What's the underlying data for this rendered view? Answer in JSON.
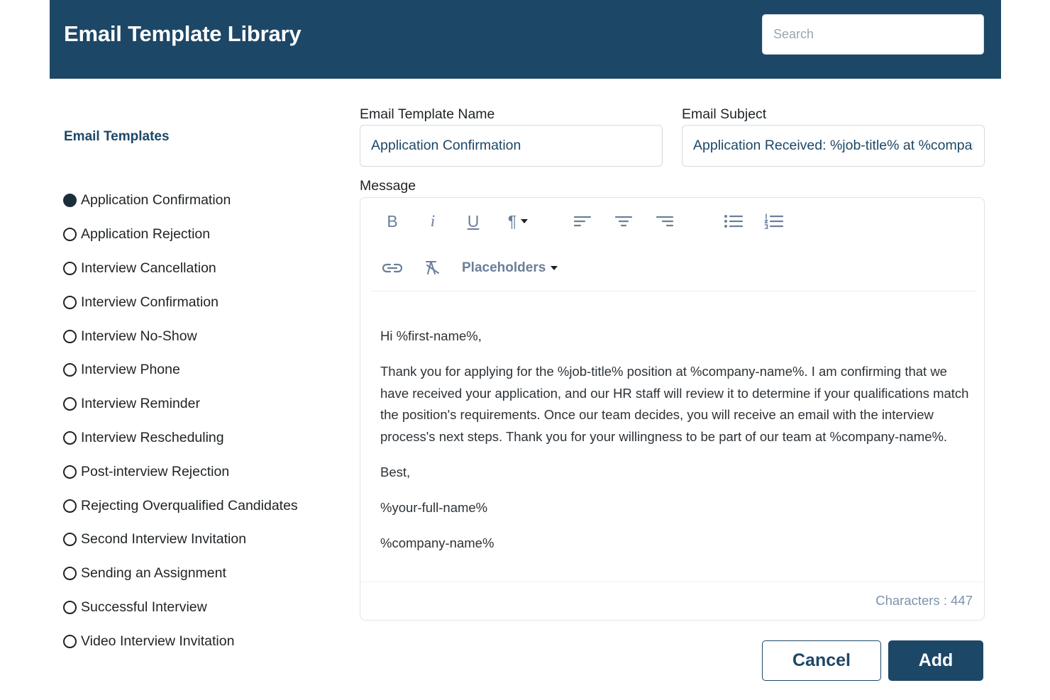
{
  "header": {
    "title": "Email Template Library",
    "search_placeholder": "Search"
  },
  "sidebar": {
    "title": "Email Templates",
    "selected": "Application Confirmation",
    "items": [
      {
        "label": "Application Confirmation",
        "checked": true
      },
      {
        "label": "Application Rejection",
        "checked": false
      },
      {
        "label": "Interview Cancellation",
        "checked": false
      },
      {
        "label": "Interview Confirmation",
        "checked": false
      },
      {
        "label": "Interview No-Show",
        "checked": false
      },
      {
        "label": "Interview Phone",
        "checked": false
      },
      {
        "label": "Interview Reminder",
        "checked": false
      },
      {
        "label": "Interview Rescheduling",
        "checked": false
      },
      {
        "label": "Post-interview Rejection",
        "checked": false
      },
      {
        "label": "Rejecting Overqualified Candidates",
        "checked": false
      },
      {
        "label": "Second Interview Invitation",
        "checked": false
      },
      {
        "label": "Sending an Assignment",
        "checked": false
      },
      {
        "label": "Successful Interview",
        "checked": false
      },
      {
        "label": "Video Interview Invitation",
        "checked": false
      }
    ]
  },
  "form": {
    "name_label": "Email Template Name",
    "name_value": "Application Confirmation",
    "subject_label": "Email Subject",
    "subject_value": "Application Received: %job-title% at %company-name%",
    "message_label": "Message"
  },
  "editor": {
    "toolbar_icons": [
      "bold-icon",
      "italic-icon",
      "underline-icon",
      "paragraph-icon",
      "align-left-icon",
      "align-center-icon",
      "align-right-icon",
      "bullet-list-icon",
      "numbered-list-icon",
      "link-icon",
      "clear-format-icon"
    ],
    "toolbar_glyphs": {
      "bold": "B",
      "italic": "i",
      "underline": "U",
      "paragraph": "¶"
    },
    "placeholders_label": "Placeholders",
    "body": {
      "greeting": "Hi %first-name%,",
      "paragraph": "Thank you for applying for the %job-title% position at %company-name%. I am confirming that we have received your application, and our HR staff will review it to determine if your qualifications match the position's requirements. Once our team decides, you will receive an email with the interview process's next steps. Thank you for your willingness to be part of our team at %company-name%.",
      "closing": "Best,",
      "signature_name": "%your-full-name%",
      "signature_company": "%company-name%"
    },
    "char_count": "Characters : 447"
  },
  "actions": {
    "cancel_label": "Cancel",
    "add_label": "Add"
  },
  "colors": {
    "primary": "#1d4767",
    "icon": "#6b7f99",
    "count_text": "#7d93ad"
  }
}
